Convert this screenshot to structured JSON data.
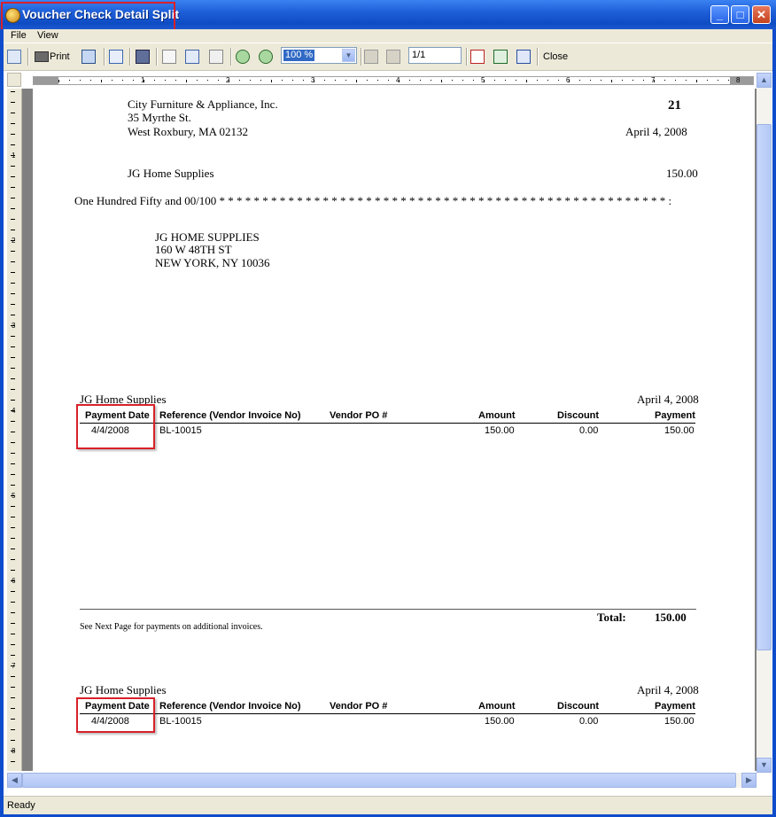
{
  "window": {
    "title": "Voucher Check Detail Split"
  },
  "menu": {
    "file": "File",
    "view": "View"
  },
  "toolbar": {
    "print_label": "Print",
    "zoom_value": "100 %",
    "page_value": "1/1",
    "close_label": "Close"
  },
  "ruler": {
    "h_numbers": [
      "1",
      "2",
      "3",
      "4",
      "5",
      "6",
      "7",
      "8"
    ],
    "v_numbers": [
      "1",
      "2",
      "3",
      "4",
      "5",
      "6",
      "7",
      "8"
    ]
  },
  "check": {
    "company_name": "City Furniture & Appliance, Inc.",
    "company_address1": "35 Myrthe St.",
    "company_address2": "West Roxbury, MA 02132",
    "check_number": "21",
    "date": "April 4, 2008",
    "payee": "JG Home Supplies",
    "amount": "150.00",
    "amount_words": "One Hundred Fifty and 00/100 * * * * * * * * * * * * * * * * * * * * * * * * * * * * * * * * * * * * * * * * * * * * * * * * * * * * :",
    "address_line1": "JG HOME SUPPLIES",
    "address_line2": "160 W 48TH ST",
    "address_line3": "NEW YORK, NY 10036"
  },
  "stubs": [
    {
      "vendor": "JG Home Supplies",
      "date": "April 4, 2008",
      "headers": [
        "Payment Date",
        "Reference (Vendor Invoice No)",
        "Vendor PO #",
        "Amount",
        "Discount",
        "Payment"
      ],
      "row": [
        "4/4/2008",
        "BL-10015",
        "",
        "150.00",
        "0.00",
        "150.00"
      ],
      "total_label": "Total:",
      "total_value": "150.00",
      "note": "See Next Page for payments on additional invoices."
    },
    {
      "vendor": "JG Home Supplies",
      "date": "April 4, 2008",
      "headers": [
        "Payment Date",
        "Reference (Vendor Invoice No)",
        "Vendor PO #",
        "Amount",
        "Discount",
        "Payment"
      ],
      "row": [
        "4/4/2008",
        "BL-10015",
        "",
        "150.00",
        "0.00",
        "150.00"
      ]
    }
  ],
  "status": {
    "text": "Ready"
  },
  "colors": {
    "title_bar": "#0e4cc4",
    "highlight": "#d8212a",
    "chrome": "#ece9d8"
  }
}
